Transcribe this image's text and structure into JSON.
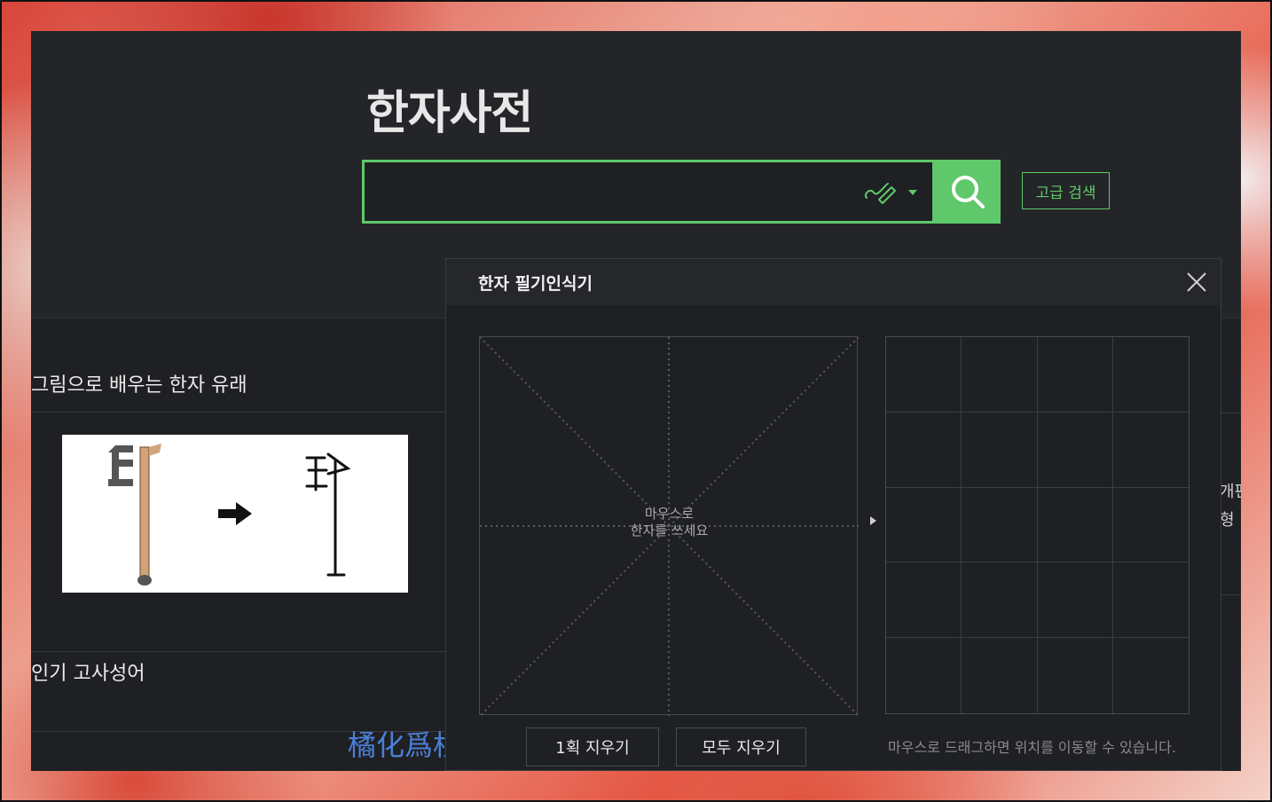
{
  "header": {
    "logo": "한자사전",
    "search": {
      "value": "",
      "placeholder": ""
    },
    "advanced_search_label": "고급 검색"
  },
  "left": {
    "origin_section_title": "그림으로 배우는 한자 유래",
    "idiom_section_title": "인기 고사성어",
    "idiom_link": "橘化爲枳"
  },
  "right_strip": {
    "line1": "개편",
    "line2": "형 :"
  },
  "popup": {
    "title": "한자 필기인식기",
    "draw_hint_line1": "마우스로",
    "draw_hint_line2": "한자를 쓰세요",
    "undo_stroke_label": "1획 지우기",
    "clear_all_label": "모두 지우기",
    "drag_hint": "마우스로 드래그하면 위치를 이동할 수 있습니다."
  },
  "colors": {
    "accent": "#5fc86b",
    "link": "#4a7fd8",
    "bg": "#1f2023"
  },
  "icons": [
    "handwriting-pen-icon",
    "dropdown-caret-icon",
    "search-icon",
    "close-icon",
    "next-arrow-icon"
  ]
}
